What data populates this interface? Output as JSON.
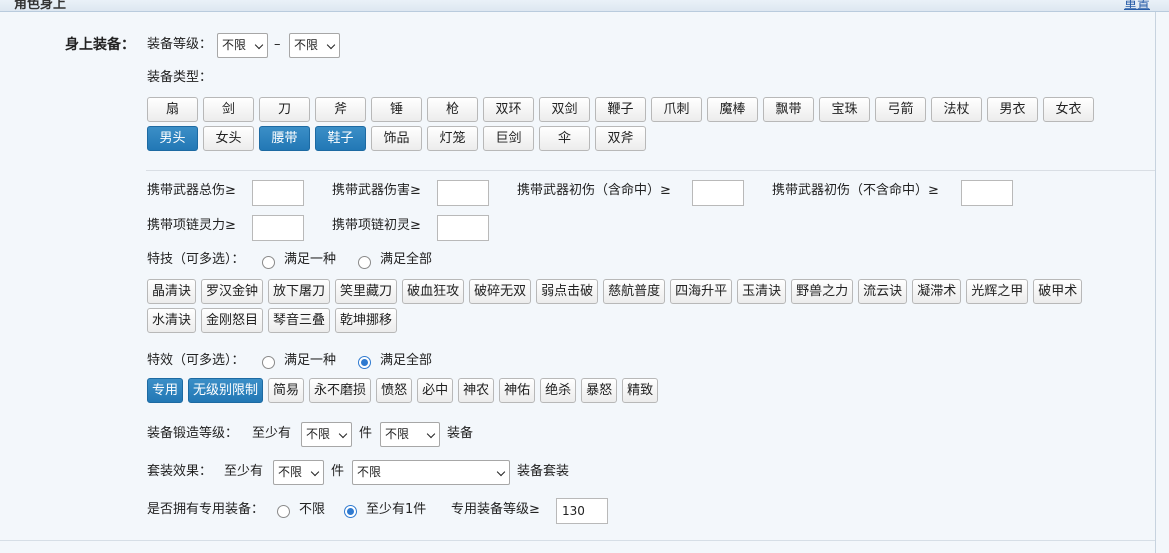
{
  "header": {
    "title": "角色身上",
    "reset": "重置"
  },
  "equip": {
    "section_label": "身上装备：",
    "level_label": "装备等级：",
    "level_min": "不限",
    "level_dash": "–",
    "level_max": "不限",
    "type_label": "装备类型：",
    "types": [
      {
        "label": "扇",
        "on": false
      },
      {
        "label": "剑",
        "on": false
      },
      {
        "label": "刀",
        "on": false
      },
      {
        "label": "斧",
        "on": false
      },
      {
        "label": "锤",
        "on": false
      },
      {
        "label": "枪",
        "on": false
      },
      {
        "label": "双环",
        "on": false
      },
      {
        "label": "双剑",
        "on": false
      },
      {
        "label": "鞭子",
        "on": false
      },
      {
        "label": "爪刺",
        "on": false
      },
      {
        "label": "魔棒",
        "on": false
      },
      {
        "label": "飘带",
        "on": false
      },
      {
        "label": "宝珠",
        "on": false
      },
      {
        "label": "弓箭",
        "on": false
      },
      {
        "label": "法杖",
        "on": false
      },
      {
        "label": "男衣",
        "on": false
      },
      {
        "label": "女衣",
        "on": false
      },
      {
        "label": "男头",
        "on": true
      },
      {
        "label": "女头",
        "on": false
      },
      {
        "label": "腰带",
        "on": true
      },
      {
        "label": "鞋子",
        "on": true
      },
      {
        "label": "饰品",
        "on": false
      },
      {
        "label": "灯笼",
        "on": false
      },
      {
        "label": "巨剑",
        "on": false
      },
      {
        "label": "伞",
        "on": false
      },
      {
        "label": "双斧",
        "on": false
      }
    ]
  },
  "stats": {
    "weapon_total": "携带武器总伤≥",
    "weapon_dmg": "携带武器伤害≥",
    "weapon_init_hit": "携带武器初伤（含命中）≥",
    "weapon_init_nohit": "携带武器初伤（不含命中）≥",
    "necklace_spirit": "携带项链灵力≥",
    "necklace_init": "携带项链初灵≥"
  },
  "skills": {
    "label": "特技（可多选）：",
    "opt_any": "满足一种",
    "opt_all": "满足全部",
    "items": [
      {
        "label": "晶清诀",
        "on": false
      },
      {
        "label": "罗汉金钟",
        "on": false
      },
      {
        "label": "放下屠刀",
        "on": false
      },
      {
        "label": "笑里藏刀",
        "on": false
      },
      {
        "label": "破血狂攻",
        "on": false
      },
      {
        "label": "破碎无双",
        "on": false
      },
      {
        "label": "弱点击破",
        "on": false
      },
      {
        "label": "慈航普度",
        "on": false
      },
      {
        "label": "四海升平",
        "on": false
      },
      {
        "label": "玉清诀",
        "on": false
      },
      {
        "label": "野兽之力",
        "on": false
      },
      {
        "label": "流云诀",
        "on": false
      },
      {
        "label": "凝滞术",
        "on": false
      },
      {
        "label": "光辉之甲",
        "on": false
      },
      {
        "label": "破甲术",
        "on": false
      },
      {
        "label": "水清诀",
        "on": false
      },
      {
        "label": "金刚怒目",
        "on": false
      },
      {
        "label": "琴音三叠",
        "on": false
      },
      {
        "label": "乾坤挪移",
        "on": false
      }
    ]
  },
  "effects": {
    "label": "特效（可多选）：",
    "opt_any": "满足一种",
    "opt_all": "满足全部",
    "items": [
      {
        "label": "专用",
        "on": true
      },
      {
        "label": "无级别限制",
        "on": true
      },
      {
        "label": "简易",
        "on": false
      },
      {
        "label": "永不磨损",
        "on": false
      },
      {
        "label": "愤怒",
        "on": false
      },
      {
        "label": "必中",
        "on": false
      },
      {
        "label": "神农",
        "on": false
      },
      {
        "label": "神佑",
        "on": false
      },
      {
        "label": "绝杀",
        "on": false
      },
      {
        "label": "暴怒",
        "on": false
      },
      {
        "label": "精致",
        "on": false
      }
    ]
  },
  "forge": {
    "label": "装备锻造等级：",
    "at_least": "至少有",
    "level": "不限",
    "unit": "件",
    "count": "不限",
    "suffix": "装备"
  },
  "set": {
    "label": "套装效果：",
    "at_least": "至少有",
    "count": "不限",
    "unit": "件",
    "effect": "不限",
    "suffix": "装备套装"
  },
  "special": {
    "label": "是否拥有专用装备：",
    "opt_none": "不限",
    "opt_one": "至少有1件",
    "level_label": "专用装备等级≥",
    "level_value": "130"
  }
}
